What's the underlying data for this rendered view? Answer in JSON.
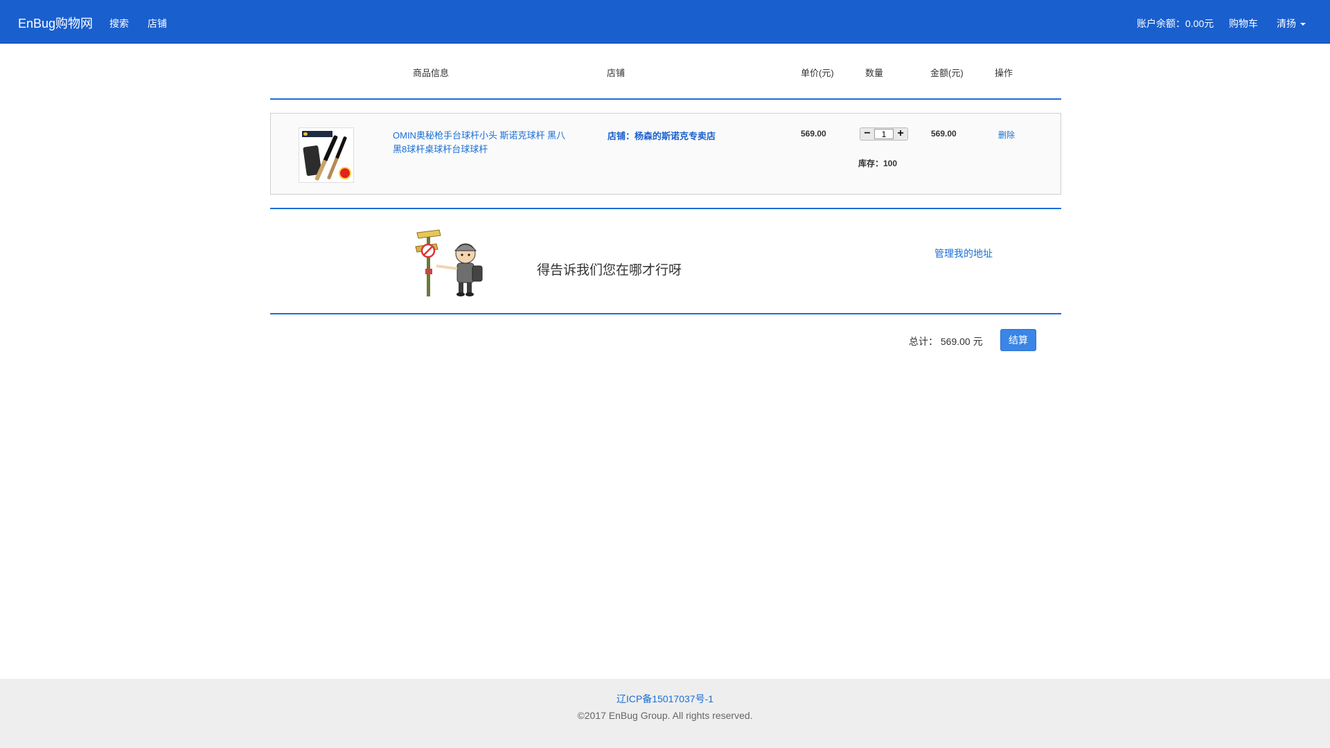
{
  "navbar": {
    "brand": "EnBug购物网",
    "search": "搜索",
    "shop": "店铺",
    "balance": "账户余额：0.00元",
    "cart": "购物车",
    "user": "清扬"
  },
  "table_headers": {
    "info": "商品信息",
    "shop": "店铺",
    "unit_price": "单价(元)",
    "quantity": "数量",
    "amount": "金额(元)",
    "operation": "操作"
  },
  "cart_items": [
    {
      "name": "OMIN奥秘枪手台球杆小头 斯诺克球杆 黑八黑8球杆桌球杆台球球杆",
      "shop": "店铺：杨森的斯诺克专卖店",
      "unit_price": "569.00",
      "quantity": "1",
      "stock": "库存：100",
      "amount": "569.00",
      "delete_label": "删除"
    }
  ],
  "address": {
    "message": "得告诉我们您在哪才行呀",
    "manage_link": "管理我的地址"
  },
  "summary": {
    "total_text": "总计： 569.00 元",
    "checkout_label": "结算"
  },
  "footer": {
    "icp": "辽ICP备15017037号-1",
    "copyright": "©2017 EnBug Group. All rights reserved."
  },
  "colors": {
    "navbar": "#1a5fce",
    "link": "#1a6fd6",
    "button": "#3a85e6",
    "footer_bg": "#eeeeee"
  }
}
